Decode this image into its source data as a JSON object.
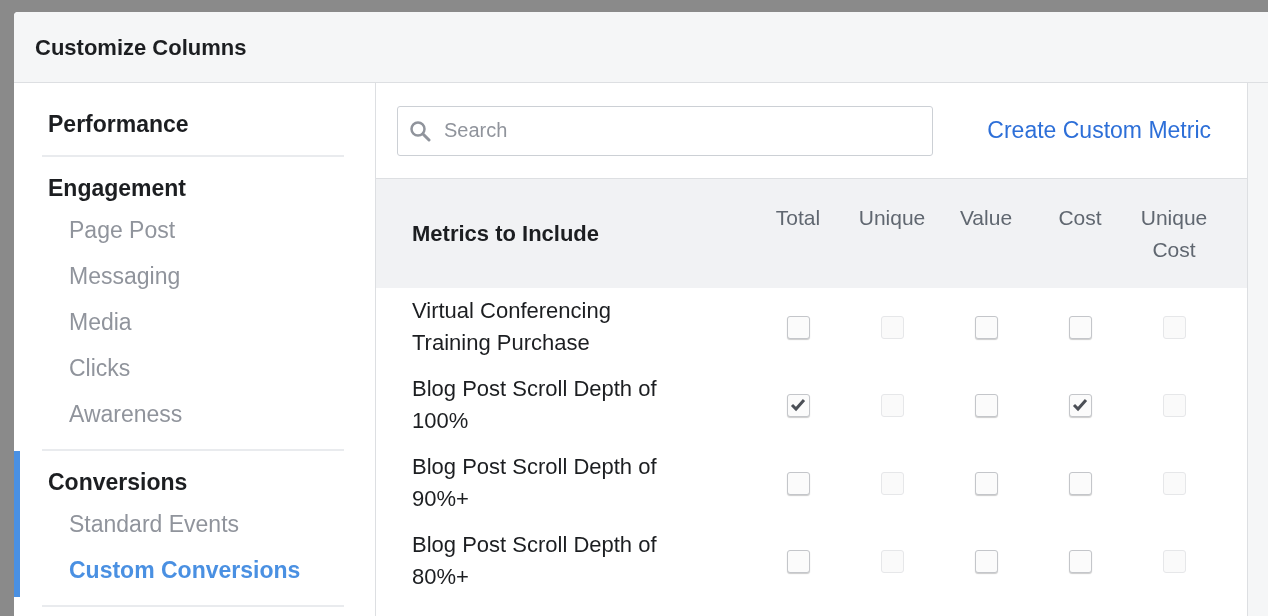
{
  "window": {
    "title": "Customize Columns"
  },
  "sidebar": {
    "groups": [
      {
        "label": "Performance",
        "selected": false
      },
      {
        "label": "Engagement",
        "selected": false,
        "items": [
          {
            "label": "Page Post",
            "selected": false
          },
          {
            "label": "Messaging",
            "selected": false
          },
          {
            "label": "Media",
            "selected": false
          },
          {
            "label": "Clicks",
            "selected": false
          },
          {
            "label": "Awareness",
            "selected": false
          }
        ]
      },
      {
        "label": "Conversions",
        "selected": true,
        "items": [
          {
            "label": "Standard Events",
            "selected": false
          },
          {
            "label": "Custom Conversions",
            "selected": true
          }
        ]
      }
    ]
  },
  "search": {
    "placeholder": "Search"
  },
  "create_link": "Create Custom Metric",
  "table": {
    "title": "Metrics to Include",
    "columns": [
      "Total",
      "Unique",
      "Value",
      "Cost",
      "Unique Cost"
    ],
    "rows": [
      {
        "label": "Virtual Conferencing Training Purchase",
        "cells": [
          {
            "checked": false,
            "disabled": false
          },
          {
            "checked": false,
            "disabled": true
          },
          {
            "checked": false,
            "disabled": false
          },
          {
            "checked": false,
            "disabled": false
          },
          {
            "checked": false,
            "disabled": true
          }
        ]
      },
      {
        "label": "Blog Post Scroll Depth of 100%",
        "cells": [
          {
            "checked": true,
            "disabled": false
          },
          {
            "checked": false,
            "disabled": true
          },
          {
            "checked": false,
            "disabled": false
          },
          {
            "checked": true,
            "disabled": false
          },
          {
            "checked": false,
            "disabled": true
          }
        ]
      },
      {
        "label": "Blog Post Scroll Depth of 90%+",
        "cells": [
          {
            "checked": false,
            "disabled": false
          },
          {
            "checked": false,
            "disabled": true
          },
          {
            "checked": false,
            "disabled": false
          },
          {
            "checked": false,
            "disabled": false
          },
          {
            "checked": false,
            "disabled": true
          }
        ]
      },
      {
        "label": "Blog Post Scroll Depth of 80%+",
        "cells": [
          {
            "checked": false,
            "disabled": false
          },
          {
            "checked": false,
            "disabled": true
          },
          {
            "checked": false,
            "disabled": false
          },
          {
            "checked": false,
            "disabled": false
          },
          {
            "checked": false,
            "disabled": true
          }
        ]
      }
    ]
  }
}
